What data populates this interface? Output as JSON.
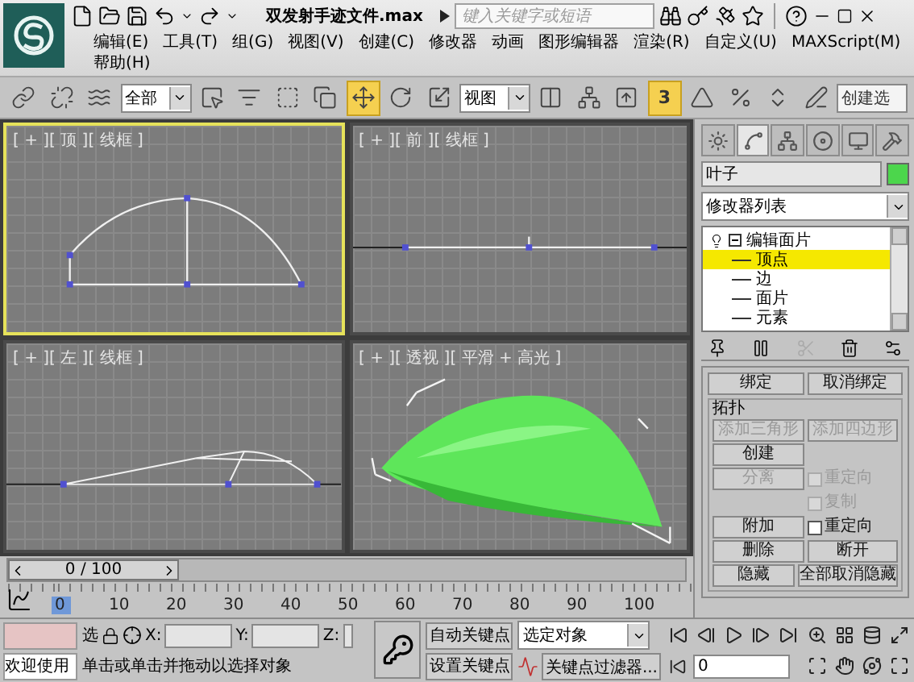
{
  "title_bar": {
    "title": "双发射手迹文件.max",
    "search": {
      "placeholder": "键入关键字或短语"
    }
  },
  "menu": [
    "编辑(E)",
    "工具(T)",
    "组(G)",
    "视图(V)",
    "创建(C)",
    "修改器",
    "动画",
    "图形编辑器",
    "渲染(R)",
    "自定义(U)",
    "MAXScript(M)",
    "帮助(H)"
  ],
  "toolbar": [
    {
      "kind": "link",
      "active": false
    },
    {
      "kind": "unlink",
      "active": false
    },
    {
      "kind": "bind",
      "active": false
    },
    {
      "kind": "dropdown",
      "value": "全部"
    },
    {
      "kind": "select",
      "active": false
    },
    {
      "kind": "select_by_name",
      "active": false
    },
    {
      "kind": "region",
      "active": false
    },
    {
      "kind": "crossing",
      "active": false
    },
    {
      "kind": "move",
      "active": true
    },
    {
      "kind": "rotate",
      "active": false
    },
    {
      "kind": "scale",
      "active": false
    },
    {
      "kind": "dropdown",
      "value": "视图"
    },
    {
      "kind": "pivot",
      "active": false
    },
    {
      "kind": "manipulate",
      "active": false
    },
    {
      "kind": "override",
      "active": false
    },
    {
      "kind": "snap",
      "label": "3",
      "active": true
    },
    {
      "kind": "angle_snap",
      "active": false
    },
    {
      "kind": "percent_snap",
      "active": false
    },
    {
      "kind": "spinner_snap",
      "active": false
    },
    {
      "kind": "edit_named",
      "active": false
    },
    {
      "kind": "field",
      "value": "创建选"
    }
  ],
  "viewports": [
    {
      "label": "[ + ][ 顶 ][ 线框 ]",
      "kind": "top",
      "selected": true
    },
    {
      "label": "[ + ][ 前 ][ 线框 ]",
      "kind": "front",
      "selected": false
    },
    {
      "label": "[ + ][ 左 ][ 线框 ]",
      "kind": "left",
      "selected": false
    },
    {
      "label": "[ + ][ 透视 ][ 平滑 + 高光 ]",
      "kind": "perspective",
      "selected": false
    }
  ],
  "command_panel": {
    "tabs": [
      {
        "kind": "create",
        "selected": false
      },
      {
        "kind": "modify",
        "selected": true
      },
      {
        "kind": "hierarchy",
        "selected": false
      },
      {
        "kind": "motion",
        "selected": false
      },
      {
        "kind": "display",
        "selected": false
      },
      {
        "kind": "utilities",
        "selected": false
      }
    ],
    "object_name": "叶子",
    "modifier_list": "修改器列表",
    "stack": [
      {
        "label": "编辑面片",
        "expanded": true,
        "children": [
          {
            "label": "顶点",
            "selected": true
          },
          {
            "label": "边",
            "selected": false
          },
          {
            "label": "面片",
            "selected": false
          },
          {
            "label": "元素",
            "selected": false
          }
        ]
      }
    ],
    "bind_buttons": [
      {
        "label": "绑定",
        "disabled": false
      },
      {
        "label": "取消绑定",
        "disabled": false
      }
    ],
    "topology": {
      "title": "拓扑",
      "rows": [
        [
          {
            "kind": "button",
            "label": "添加三角形",
            "disabled": true
          },
          {
            "kind": "button",
            "label": "添加四边形",
            "disabled": true
          }
        ],
        [
          {
            "kind": "button",
            "label": "创建",
            "disabled": false
          }
        ],
        [
          {
            "kind": "button",
            "label": "分离",
            "disabled": true
          },
          {
            "kind": "checkbox",
            "label": "重定向",
            "checked": false,
            "disabled": true
          }
        ],
        [
          {
            "kind": "spacer"
          },
          {
            "kind": "checkbox",
            "label": "复制",
            "checked": false,
            "disabled": true
          }
        ],
        [
          {
            "kind": "button",
            "label": "附加",
            "disabled": false
          },
          {
            "kind": "checkbox",
            "label": "重定向",
            "checked": false,
            "disabled": false
          }
        ],
        [
          {
            "kind": "button",
            "label": "删除",
            "disabled": false
          },
          {
            "kind": "button",
            "label": "断开",
            "disabled": false
          }
        ],
        [
          {
            "kind": "button",
            "label": "隐藏",
            "disabled": false
          },
          {
            "kind": "button",
            "label": "全部取消隐藏",
            "disabled": false
          }
        ]
      ]
    }
  },
  "time_slider": {
    "position": "0 / 100",
    "level": 0
  },
  "ruler": [
    {
      "label": "0",
      "current": true
    },
    {
      "label": "10",
      "current": false
    },
    {
      "label": "20",
      "current": false
    },
    {
      "label": "30",
      "current": false
    },
    {
      "label": "40",
      "current": false
    },
    {
      "label": "50",
      "current": false
    },
    {
      "label": "60",
      "current": false
    },
    {
      "label": "70",
      "current": false
    },
    {
      "label": "80",
      "current": false
    },
    {
      "label": "90",
      "current": false
    },
    {
      "label": "100",
      "current": false
    }
  ],
  "status_bar": {
    "welcome": "欢迎使用",
    "selection_label": "选",
    "coords": [
      {
        "label": "X:"
      },
      {
        "label": "Y:"
      },
      {
        "label": "Z:"
      }
    ],
    "prompt": "单击或单击并拖动以选择对象",
    "auto_key": "自动关键点",
    "set_key": "设置关键点",
    "key_mode": "选定对象",
    "key_filters": "关键点过滤器...",
    "frame": "0"
  }
}
